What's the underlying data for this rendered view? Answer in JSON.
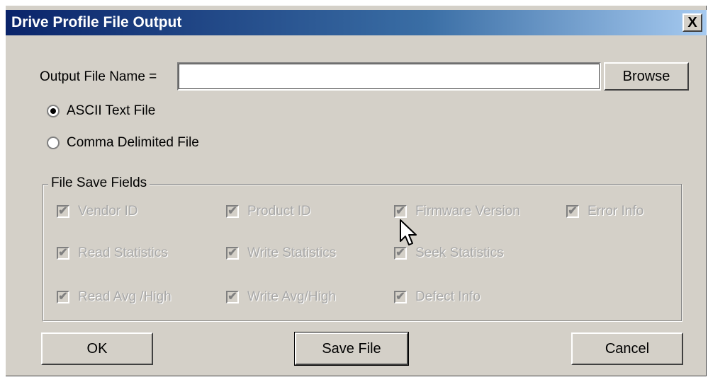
{
  "window": {
    "title": "Drive Profile File Output",
    "close_glyph": "X"
  },
  "form": {
    "output_label": "Output File Name =",
    "output_value": "",
    "output_placeholder": "",
    "browse_label": "Browse",
    "radio_options": [
      {
        "label": "ASCII Text File",
        "selected": true
      },
      {
        "label": "Comma Delimited File",
        "selected": false
      }
    ]
  },
  "fields_group": {
    "title": "File Save Fields",
    "checkboxes": [
      {
        "label": "Vendor ID",
        "checked": true,
        "enabled": false
      },
      {
        "label": "Product ID",
        "checked": true,
        "enabled": false
      },
      {
        "label": "Firmware Version",
        "checked": true,
        "enabled": false
      },
      {
        "label": "Error Info",
        "checked": true,
        "enabled": false
      },
      {
        "label": "Read Statistics",
        "checked": true,
        "enabled": false
      },
      {
        "label": "Write Statistics",
        "checked": true,
        "enabled": false
      },
      {
        "label": "Seek Statistics",
        "checked": true,
        "enabled": false
      },
      {
        "label": "Read Avg /High",
        "checked": true,
        "enabled": false
      },
      {
        "label": "Write Avg/High",
        "checked": true,
        "enabled": false
      },
      {
        "label": "Defect Info",
        "checked": true,
        "enabled": false
      }
    ]
  },
  "buttons": {
    "ok": "OK",
    "save": "Save File",
    "cancel": "Cancel"
  },
  "icons": {
    "cursor": "mouse-pointer-icon",
    "check": "checkmark-icon"
  },
  "colors": {
    "title_gradient_start": "#0a246a",
    "title_gradient_end": "#a6caf0",
    "window_face": "#d4d0c8",
    "disabled_text": "#a8a8a8"
  }
}
